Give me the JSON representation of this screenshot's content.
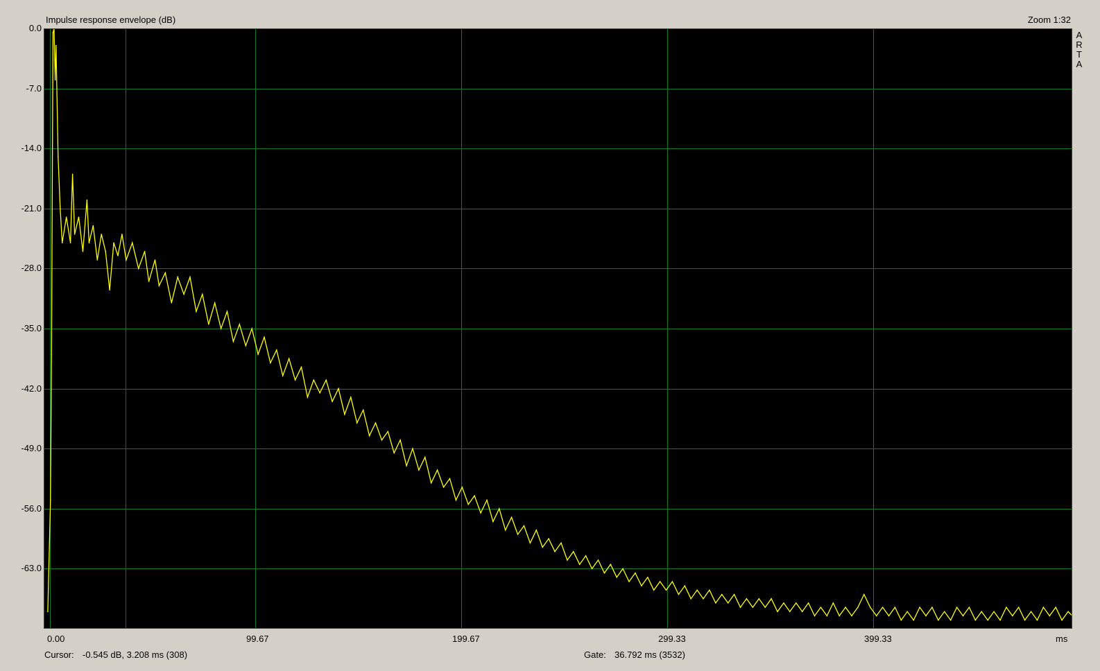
{
  "window": {
    "title": "Impulse response envelope (dB)",
    "zoom": "Zoom 1:32",
    "brand_letters": [
      "A",
      "R",
      "T",
      "A"
    ]
  },
  "status": {
    "cursor_label": "Cursor:",
    "cursor_value": "-0.545 dB,    3.208 ms  (308)",
    "gate_label": "Gate:",
    "gate_value": "36.792 ms  (3532)"
  },
  "colors": {
    "plot_bg": "#000000",
    "grid": "#0b7a2a",
    "trace": "#ffff00",
    "cursor": "#cc1111",
    "window_bg": "#d4d0c8"
  },
  "chart_data": {
    "type": "line",
    "title": "Impulse response envelope (dB)",
    "xlabel": "ms",
    "ylabel": "",
    "xlim": [
      -3.0,
      496.0
    ],
    "ylim": [
      -70.0,
      0.0
    ],
    "x_tick_labels": [
      "0.00",
      "99.67",
      "199.67",
      "299.33",
      "399.33",
      "ms"
    ],
    "x_ticks": [
      0.0,
      99.67,
      199.67,
      299.33,
      399.33
    ],
    "y_tick_labels": [
      "0.0",
      "-7.0",
      "-14.0",
      "-21.0",
      "-28.0",
      "-35.0",
      "-42.0",
      "-49.0",
      "-56.0",
      "-63.0"
    ],
    "y_ticks": [
      0.0,
      -7.0,
      -14.0,
      -21.0,
      -28.0,
      -35.0,
      -42.0,
      -49.0,
      -56.0,
      -63.0
    ],
    "grid": true,
    "cursor_x_ms": 36.792,
    "series": [
      {
        "values_xy": [
          [
            -1.0,
            -68.0
          ],
          [
            0.3,
            -55.0
          ],
          [
            0.8,
            -38.0
          ],
          [
            1.5,
            -0.5
          ],
          [
            2.0,
            0.0
          ],
          [
            2.6,
            -6.0
          ],
          [
            3.0,
            -2.0
          ],
          [
            4.0,
            -15.0
          ],
          [
            5.0,
            -21.0
          ],
          [
            6.0,
            -25.0
          ],
          [
            8.0,
            -22.0
          ],
          [
            10.0,
            -25.0
          ],
          [
            11.0,
            -17.0
          ],
          [
            12.0,
            -24.0
          ],
          [
            14.0,
            -22.0
          ],
          [
            16.0,
            -26.0
          ],
          [
            18.0,
            -20.0
          ],
          [
            19.0,
            -25.0
          ],
          [
            21.0,
            -23.0
          ],
          [
            23.0,
            -27.0
          ],
          [
            25.0,
            -24.0
          ],
          [
            27.0,
            -26.0
          ],
          [
            29.0,
            -30.5
          ],
          [
            31.0,
            -25.0
          ],
          [
            33.0,
            -26.5
          ],
          [
            35.0,
            -24.0
          ],
          [
            37.0,
            -27.0
          ],
          [
            40.0,
            -25.0
          ],
          [
            43.0,
            -28.0
          ],
          [
            46.0,
            -26.0
          ],
          [
            48.0,
            -29.5
          ],
          [
            51.0,
            -27.0
          ],
          [
            53.0,
            -30.0
          ],
          [
            56.0,
            -28.5
          ],
          [
            59.0,
            -32.0
          ],
          [
            62.0,
            -29.0
          ],
          [
            65.0,
            -31.0
          ],
          [
            68.0,
            -29.0
          ],
          [
            71.0,
            -33.0
          ],
          [
            74.0,
            -31.0
          ],
          [
            77.0,
            -34.5
          ],
          [
            80.0,
            -32.0
          ],
          [
            83.0,
            -35.0
          ],
          [
            86.0,
            -33.0
          ],
          [
            89.0,
            -36.5
          ],
          [
            92.0,
            -34.5
          ],
          [
            95.0,
            -37.0
          ],
          [
            98.0,
            -35.0
          ],
          [
            101.0,
            -38.0
          ],
          [
            104.0,
            -36.0
          ],
          [
            107.0,
            -39.0
          ],
          [
            110.0,
            -37.5
          ],
          [
            113.0,
            -40.5
          ],
          [
            116.0,
            -38.5
          ],
          [
            119.0,
            -41.0
          ],
          [
            122.0,
            -39.5
          ],
          [
            125.0,
            -43.0
          ],
          [
            128.0,
            -41.0
          ],
          [
            131.0,
            -42.5
          ],
          [
            134.0,
            -41.0
          ],
          [
            137.0,
            -43.5
          ],
          [
            140.0,
            -42.0
          ],
          [
            143.0,
            -45.0
          ],
          [
            146.0,
            -43.0
          ],
          [
            149.0,
            -46.0
          ],
          [
            152.0,
            -44.5
          ],
          [
            155.0,
            -47.5
          ],
          [
            158.0,
            -46.0
          ],
          [
            161.0,
            -48.0
          ],
          [
            164.0,
            -47.0
          ],
          [
            167.0,
            -49.5
          ],
          [
            170.0,
            -48.0
          ],
          [
            173.0,
            -51.0
          ],
          [
            176.0,
            -49.0
          ],
          [
            179.0,
            -51.5
          ],
          [
            182.0,
            -50.0
          ],
          [
            185.0,
            -53.0
          ],
          [
            188.0,
            -51.5
          ],
          [
            191.0,
            -53.5
          ],
          [
            194.0,
            -52.5
          ],
          [
            197.0,
            -55.0
          ],
          [
            200.0,
            -53.5
          ],
          [
            203.0,
            -55.5
          ],
          [
            206.0,
            -54.5
          ],
          [
            209.0,
            -56.5
          ],
          [
            212.0,
            -55.0
          ],
          [
            215.0,
            -57.5
          ],
          [
            218.0,
            -56.0
          ],
          [
            221.0,
            -58.5
          ],
          [
            224.0,
            -57.0
          ],
          [
            227.0,
            -59.0
          ],
          [
            230.0,
            -58.0
          ],
          [
            233.0,
            -60.0
          ],
          [
            236.0,
            -58.5
          ],
          [
            239.0,
            -60.5
          ],
          [
            242.0,
            -59.5
          ],
          [
            245.0,
            -61.0
          ],
          [
            248.0,
            -60.0
          ],
          [
            251.0,
            -62.0
          ],
          [
            254.0,
            -61.0
          ],
          [
            257.0,
            -62.5
          ],
          [
            260.0,
            -61.5
          ],
          [
            263.0,
            -63.0
          ],
          [
            266.0,
            -62.0
          ],
          [
            269.0,
            -63.5
          ],
          [
            272.0,
            -62.5
          ],
          [
            275.0,
            -64.0
          ],
          [
            278.0,
            -63.0
          ],
          [
            281.0,
            -64.5
          ],
          [
            284.0,
            -63.5
          ],
          [
            287.0,
            -65.0
          ],
          [
            290.0,
            -64.0
          ],
          [
            293.0,
            -65.5
          ],
          [
            296.0,
            -64.5
          ],
          [
            299.0,
            -65.5
          ],
          [
            302.0,
            -64.5
          ],
          [
            305.0,
            -66.0
          ],
          [
            308.0,
            -65.0
          ],
          [
            311.0,
            -66.5
          ],
          [
            314.0,
            -65.5
          ],
          [
            317.0,
            -66.5
          ],
          [
            320.0,
            -65.5
          ],
          [
            323.0,
            -67.0
          ],
          [
            326.0,
            -66.0
          ],
          [
            329.0,
            -67.0
          ],
          [
            332.0,
            -66.0
          ],
          [
            335.0,
            -67.5
          ],
          [
            338.0,
            -66.5
          ],
          [
            341.0,
            -67.5
          ],
          [
            344.0,
            -66.5
          ],
          [
            347.0,
            -67.5
          ],
          [
            350.0,
            -66.5
          ],
          [
            353.0,
            -68.0
          ],
          [
            356.0,
            -67.0
          ],
          [
            359.0,
            -68.0
          ],
          [
            362.0,
            -67.0
          ],
          [
            365.0,
            -68.0
          ],
          [
            368.0,
            -67.0
          ],
          [
            371.0,
            -68.5
          ],
          [
            374.0,
            -67.5
          ],
          [
            377.0,
            -68.5
          ],
          [
            380.0,
            -67.0
          ],
          [
            383.0,
            -68.5
          ],
          [
            386.0,
            -67.5
          ],
          [
            389.0,
            -68.5
          ],
          [
            392.0,
            -67.5
          ],
          [
            395.0,
            -66.0
          ],
          [
            398.0,
            -67.5
          ],
          [
            401.0,
            -68.5
          ],
          [
            404.0,
            -67.5
          ],
          [
            407.0,
            -68.5
          ],
          [
            410.0,
            -67.5
          ],
          [
            413.0,
            -69.0
          ],
          [
            416.0,
            -68.0
          ],
          [
            419.0,
            -69.0
          ],
          [
            422.0,
            -67.5
          ],
          [
            425.0,
            -68.5
          ],
          [
            428.0,
            -67.5
          ],
          [
            431.0,
            -69.0
          ],
          [
            434.0,
            -68.0
          ],
          [
            437.0,
            -69.0
          ],
          [
            440.0,
            -67.5
          ],
          [
            443.0,
            -68.5
          ],
          [
            446.0,
            -67.5
          ],
          [
            449.0,
            -69.0
          ],
          [
            452.0,
            -68.0
          ],
          [
            455.0,
            -69.0
          ],
          [
            458.0,
            -68.0
          ],
          [
            461.0,
            -69.0
          ],
          [
            464.0,
            -67.5
          ],
          [
            467.0,
            -68.5
          ],
          [
            470.0,
            -67.5
          ],
          [
            473.0,
            -69.0
          ],
          [
            476.0,
            -68.0
          ],
          [
            479.0,
            -69.0
          ],
          [
            482.0,
            -67.5
          ],
          [
            485.0,
            -68.5
          ],
          [
            488.0,
            -67.5
          ],
          [
            491.0,
            -69.0
          ],
          [
            494.0,
            -68.0
          ],
          [
            496.0,
            -68.5
          ]
        ]
      }
    ]
  }
}
